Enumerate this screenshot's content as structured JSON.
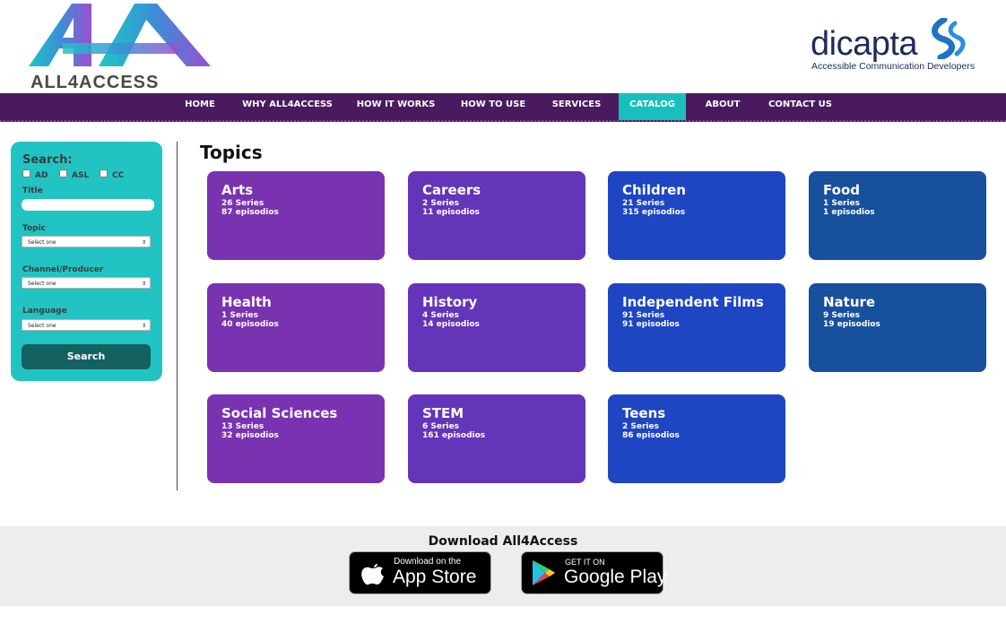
{
  "brand": {
    "logo_text": "ALL4ACCESS",
    "partner_name": "dicapta",
    "partner_tagline": "Accessible Communication Developers"
  },
  "nav": {
    "items": [
      {
        "label": "HOME"
      },
      {
        "label": "WHY ALL4ACCESS"
      },
      {
        "label": "HOW IT WORKS"
      },
      {
        "label": "HOW TO USE"
      },
      {
        "label": "SERVICES"
      },
      {
        "label": "CATALOG",
        "active": true
      },
      {
        "label": "ABOUT"
      },
      {
        "label": "CONTACT US"
      }
    ]
  },
  "search": {
    "heading": "Search:",
    "filters": [
      "AD",
      "ASL",
      "CC"
    ],
    "title_label": "Title",
    "title_value": "",
    "topic_label": "Topic",
    "topic_value": "Select one",
    "channel_label": "Channel/Producer",
    "channel_value": "Select one",
    "language_label": "Language",
    "language_value": "Select one",
    "button_label": "Search"
  },
  "topics": {
    "heading": "Topics",
    "cards": [
      {
        "name": "Arts",
        "series": "26 Series",
        "episodes": "87 episodios",
        "color": "#7a33b0"
      },
      {
        "name": "Careers",
        "series": "2 Series",
        "episodes": "11 episodios",
        "color": "#6335b8"
      },
      {
        "name": "Children",
        "series": "21 Series",
        "episodes": "315 episodios",
        "color": "#1e46c2"
      },
      {
        "name": "Food",
        "series": "1 Series",
        "episodes": "1 episodios",
        "color": "#17509c"
      },
      {
        "name": "Health",
        "series": "1 Series",
        "episodes": "40 episodios",
        "color": "#7a33b0"
      },
      {
        "name": "History",
        "series": "4 Series",
        "episodes": "14 episodios",
        "color": "#6335b8"
      },
      {
        "name": "Independent Films",
        "series": "91 Series",
        "episodes": "91 episodios",
        "color": "#1e46c2"
      },
      {
        "name": "Nature",
        "series": "9 Series",
        "episodes": "19 episodios",
        "color": "#17509c"
      },
      {
        "name": "Social Sciences",
        "series": "13 Series",
        "episodes": "32 episodios",
        "color": "#7a33b0"
      },
      {
        "name": "STEM",
        "series": "6 Series",
        "episodes": "161 episodios",
        "color": "#6335b8"
      },
      {
        "name": "Teens",
        "series": "2 Series",
        "episodes": "86 episodios",
        "color": "#1e46c2"
      }
    ]
  },
  "footer": {
    "title": "Download All4Access",
    "app_store_small": "Download on the",
    "app_store_big": "App Store",
    "google_play_small": "GET IT ON",
    "google_play_big": "Google Play"
  }
}
